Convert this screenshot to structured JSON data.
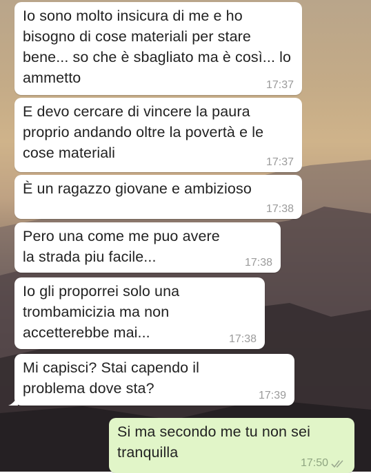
{
  "messages": [
    {
      "text": "Io sono molto insicura di me e ho bisogno di cose materiali per stare bene... so che è sbagliato ma è così... lo ammetto",
      "time": "17:37"
    },
    {
      "text": "E devo cercare di vincere la paura proprio andando oltre la povertà e le cose materiali",
      "time": "17:37"
    },
    {
      "text": "È un ragazzo giovane e ambizioso",
      "time": "17:38"
    },
    {
      "text": "Pero una come me puo avere la strada piu facile...",
      "time": "17:38"
    },
    {
      "text": "Io gli proporrei solo una trombamicizia ma non accetterebbe mai...",
      "time": "17:38"
    },
    {
      "text": "Mi capisci? Stai capendo il problema dove sta?",
      "time": "17:39"
    },
    {
      "text": "Si ma secondo me tu non sei tranquilla",
      "time": "17:50"
    }
  ],
  "colors": {
    "incoming_bubble": "#ffffff",
    "outgoing_bubble": "#e1f5c8",
    "text": "#222222",
    "timestamp": "#9a9a9a"
  },
  "icons": {
    "read_receipt": "double-check-icon"
  }
}
